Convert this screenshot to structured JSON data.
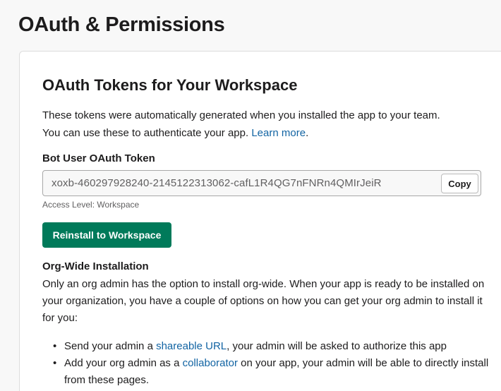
{
  "page": {
    "title": "OAuth & Permissions"
  },
  "tokens_section": {
    "title": "OAuth Tokens for Your Workspace",
    "intro_line1": "These tokens were automatically generated when you installed the app to your team.",
    "intro_line2": "You can use these to authenticate your app.",
    "learn_more": "Learn more",
    "learn_more_suffix": "."
  },
  "bot_token": {
    "label": "Bot User OAuth Token",
    "value": "xoxb-460297928240-2145122313062-cafL1R4QG7nFNRn4QMIrJeiR",
    "copy_label": "Copy",
    "access_level": "Access Level: Workspace"
  },
  "reinstall": {
    "label": "Reinstall to Workspace"
  },
  "org_wide": {
    "title": "Org-Wide Installation",
    "description": "Only an org admin has the option to install org-wide. When your app is ready to be installed on your organization, you have a couple of options on how you can get your org admin to install it for you:",
    "items": [
      {
        "prefix": "Send your admin a ",
        "link": "shareable URL",
        "suffix": ", your admin will be asked to authorize this app"
      },
      {
        "prefix": "Add your org admin as a ",
        "link": "collaborator",
        "suffix": " on your app, your admin will be able to directly install from these pages."
      }
    ]
  },
  "colors": {
    "primary_button": "#007a5a",
    "link": "#1264a3",
    "background": "#f8f8f8"
  }
}
